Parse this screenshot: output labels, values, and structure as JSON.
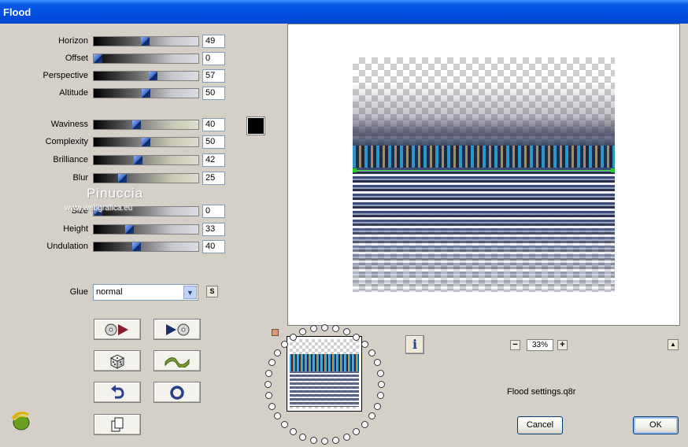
{
  "window": {
    "title": "Flood"
  },
  "sliders": [
    {
      "label": "Horizon",
      "value": "49",
      "fraction": 0.49,
      "tone": "blue"
    },
    {
      "label": "Offset",
      "value": "0",
      "fraction": 0.0,
      "tone": "blue"
    },
    {
      "label": "Perspective",
      "value": "57",
      "fraction": 0.57,
      "tone": "blue"
    },
    {
      "label": "Altitude",
      "value": "50",
      "fraction": 0.5,
      "tone": "blue"
    },
    {
      "label": "Waviness",
      "value": "40",
      "fraction": 0.4,
      "tone": "tan"
    },
    {
      "label": "Complexity",
      "value": "50",
      "fraction": 0.5,
      "tone": "tan"
    },
    {
      "label": "Brilliance",
      "value": "42",
      "fraction": 0.42,
      "tone": "tan"
    },
    {
      "label": "Blur",
      "value": "25",
      "fraction": 0.25,
      "tone": "tan"
    },
    {
      "label": "Size",
      "value": "0",
      "fraction": 0.0,
      "tone": "blue"
    },
    {
      "label": "Height",
      "value": "33",
      "fraction": 0.33,
      "tone": "blue"
    },
    {
      "label": "Undulation",
      "value": "40",
      "fraction": 0.4,
      "tone": "blue"
    }
  ],
  "color_swatch": {
    "color": "#000000"
  },
  "watermark": {
    "name": "Pinuccia",
    "site": "www.webgrafica.eu"
  },
  "glue": {
    "label": "Glue",
    "selected": "normal",
    "s_button": "S"
  },
  "tool_buttons": [
    {
      "name": "prev-preset",
      "icon": "rewind-icon"
    },
    {
      "name": "next-preset",
      "icon": "forward-icon"
    },
    {
      "name": "random",
      "icon": "dice-icon"
    },
    {
      "name": "wave",
      "icon": "wave-icon"
    },
    {
      "name": "undo",
      "icon": "undo-icon"
    },
    {
      "name": "reset",
      "icon": "ring-icon"
    },
    {
      "name": "copy",
      "icon": "copy-icon"
    }
  ],
  "zoom": {
    "value": "33%",
    "minus": "−",
    "plus": "+"
  },
  "info_button": "i",
  "settings_file": "Flood settings.q8r",
  "buttons": {
    "cancel": "Cancel",
    "ok": "OK"
  }
}
